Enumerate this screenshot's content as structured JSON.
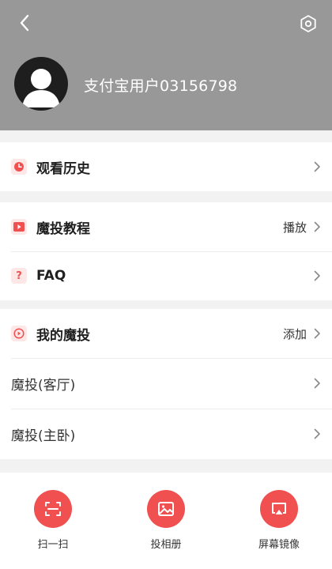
{
  "colors": {
    "header_bg": "#989898",
    "accent": "#f0504f",
    "icon_bg": "#fde7e7",
    "page_bg": "#f2f2f2"
  },
  "header": {
    "back_icon": "chevron-left-icon",
    "settings_icon": "hexagon-settings-icon",
    "username": "支付宝用户03156798"
  },
  "groups": [
    {
      "rows": [
        {
          "icon": "clock-icon",
          "label": "观看历史",
          "action": ""
        }
      ]
    },
    {
      "rows": [
        {
          "icon": "play-icon",
          "label": "魔投教程",
          "action": "播放"
        },
        {
          "icon": "question-icon",
          "label": "FAQ",
          "action": ""
        }
      ]
    },
    {
      "rows": [
        {
          "icon": "cast-circle-icon",
          "label": "我的魔投",
          "action": "添加"
        },
        {
          "icon": "",
          "label": "魔投(客厅)",
          "action": ""
        },
        {
          "icon": "",
          "label": "魔投(主卧)",
          "action": ""
        }
      ]
    }
  ],
  "bottom_bar": [
    {
      "icon": "scan-icon",
      "label": "扫一扫"
    },
    {
      "icon": "photo-album-icon",
      "label": "投相册"
    },
    {
      "icon": "screen-mirror-icon",
      "label": "屏幕镜像"
    }
  ]
}
